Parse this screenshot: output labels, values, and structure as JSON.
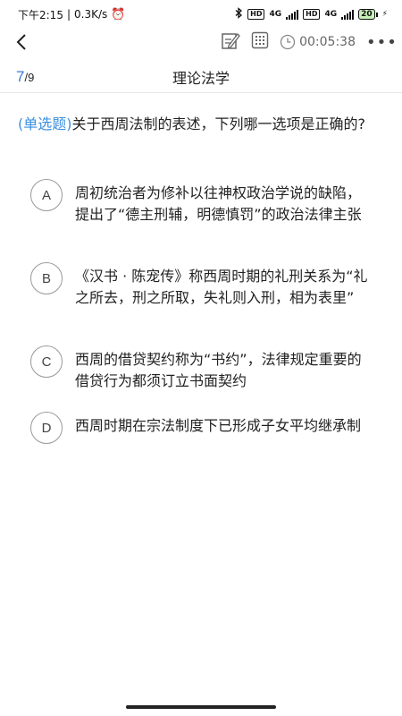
{
  "status": {
    "time": "下午2:15",
    "speed": "0.3K/s",
    "net1": "4G",
    "net2": "4G",
    "battery": "20"
  },
  "toolbar": {
    "timer": "00:05:38"
  },
  "header": {
    "current": "7",
    "separator": "/",
    "total": "9",
    "title": "理论法学"
  },
  "question": {
    "type": "(单选题)",
    "text": "关于西周法制的表述，下列哪一选项是正确的?"
  },
  "options": [
    {
      "letter": "A",
      "text": "周初统治者为修补以往神权政治学说的缺陷，提出了“德主刑辅，明德慎罚”的政治法律主张"
    },
    {
      "letter": "B",
      "text": "《汉书 · 陈宠传》称西周时期的礼刑关系为“礼之所去，刑之所取，失礼则入刑，相为表里”"
    },
    {
      "letter": "C",
      "text": "西周的借贷契约称为“书约”，法律规定重要的借贷行为都须订立书面契约"
    },
    {
      "letter": "D",
      "text": "西周时期在宗法制度下已形成子女平均继承制"
    }
  ]
}
